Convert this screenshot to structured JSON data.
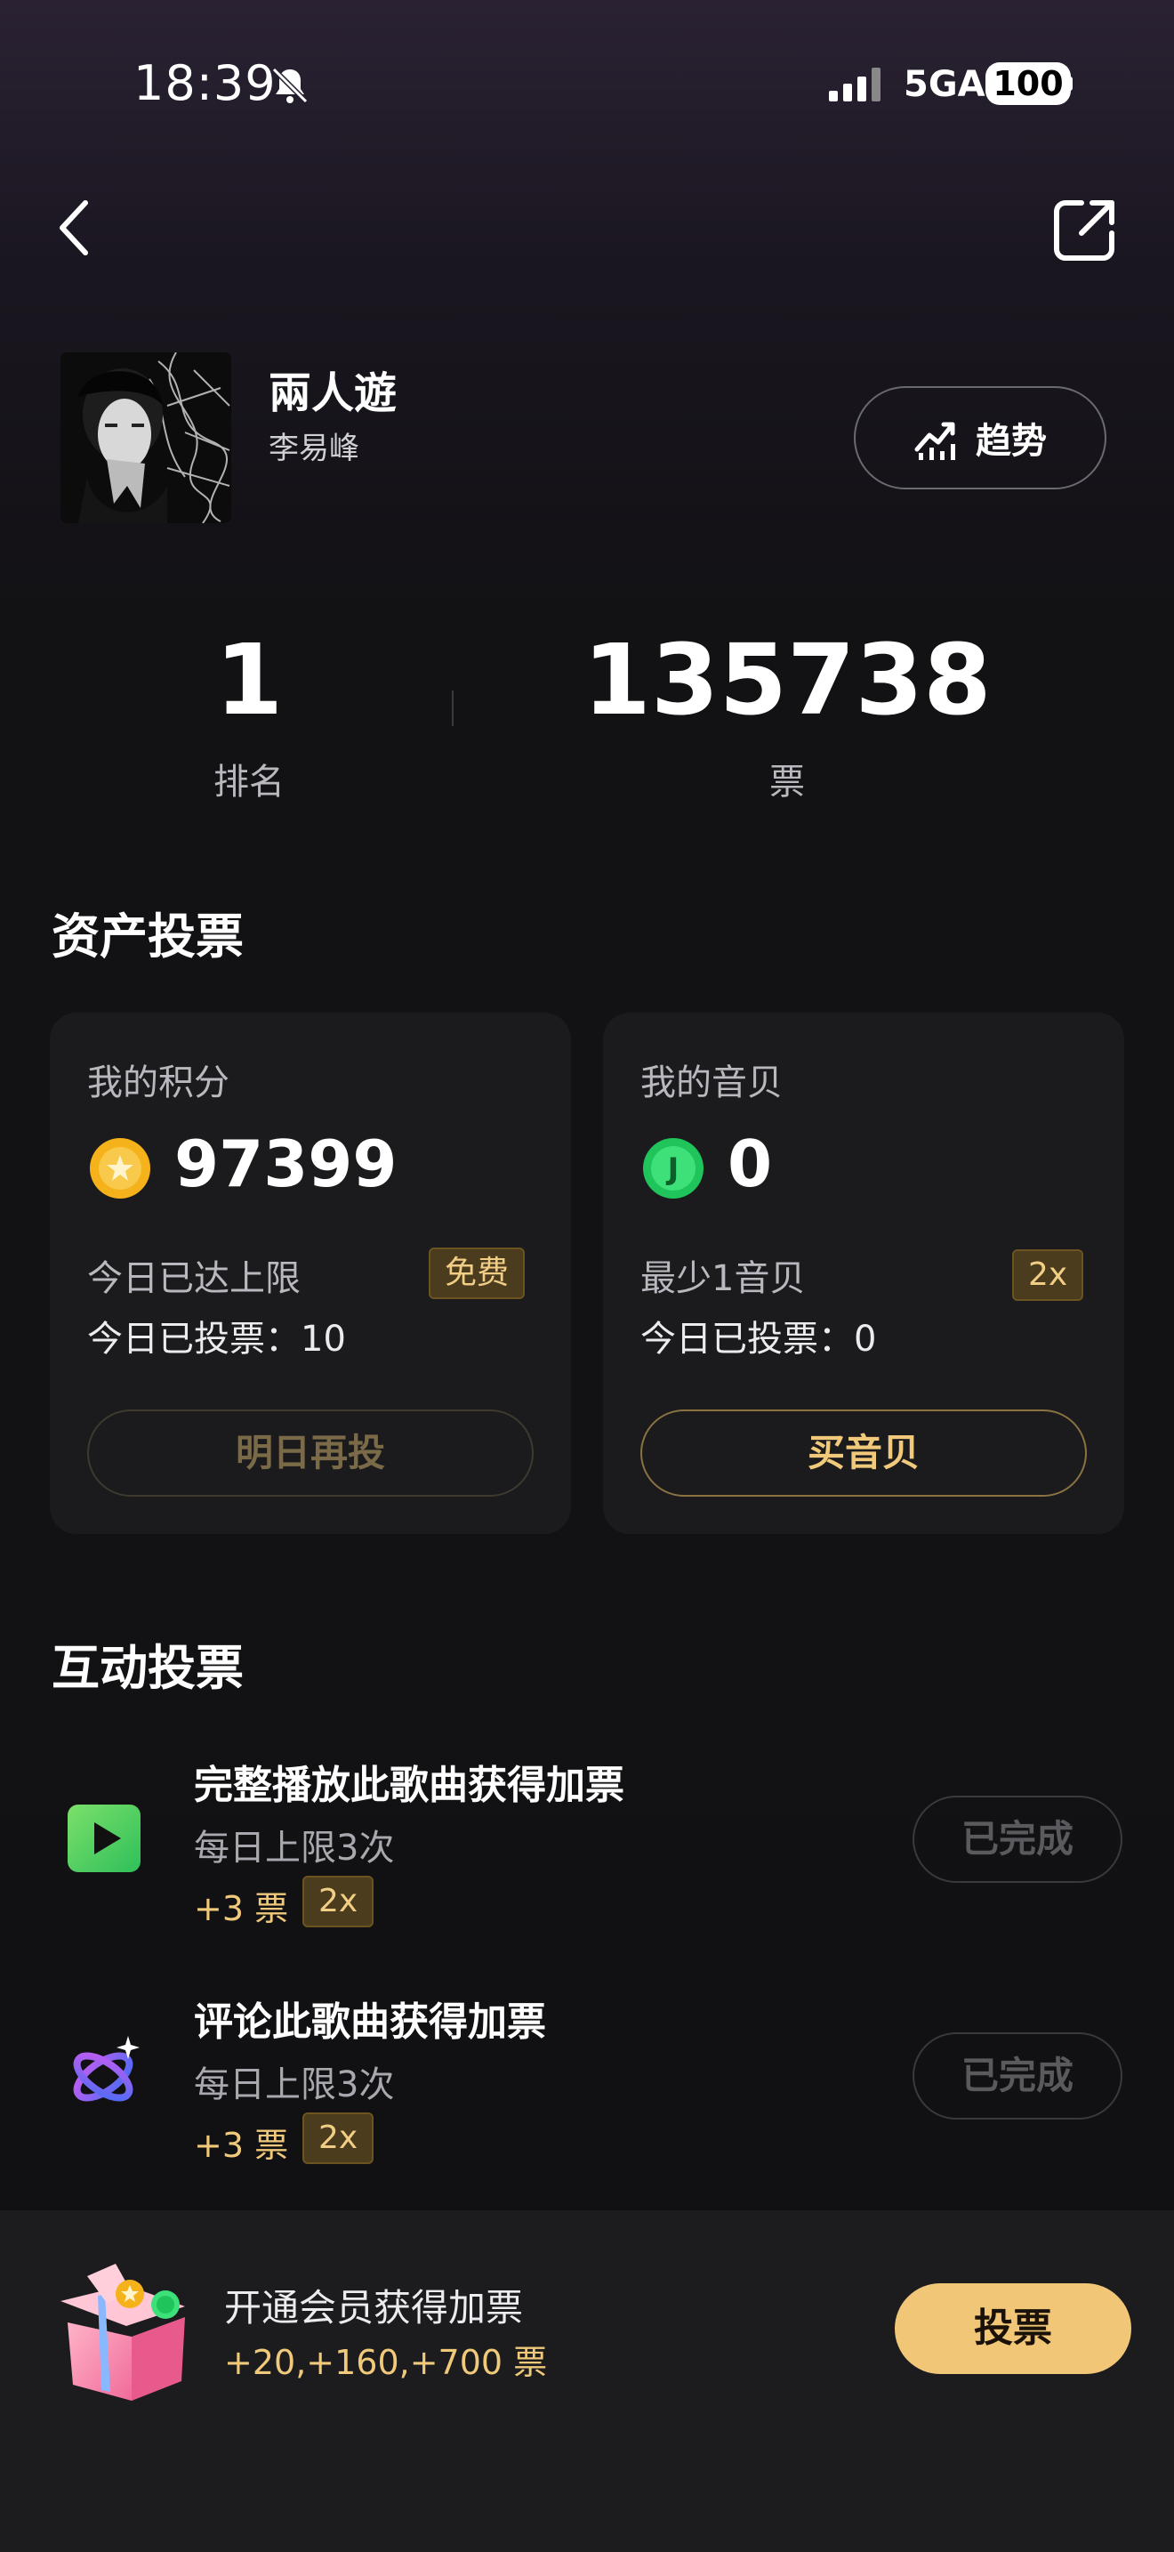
{
  "status_bar": {
    "time": "18:39",
    "network": "5GA",
    "battery": "100"
  },
  "header": {
    "back_icon": "chevron-left-icon",
    "share_icon": "share-icon"
  },
  "song": {
    "title": "兩人遊",
    "artist": "李易峰",
    "trend_label": "趋势"
  },
  "stats": {
    "rank_value": "1",
    "rank_label": "排名",
    "votes_value": "135738",
    "votes_label": "票"
  },
  "asset_section": {
    "title": "资产投票",
    "points_card": {
      "label": "我的积分",
      "value": "97399",
      "line1": "今日已达上限",
      "badge": "免费",
      "line2": "今日已投票：10",
      "button": "明日再投"
    },
    "shells_card": {
      "label": "我的音贝",
      "value": "0",
      "icon_letter": "J",
      "line1": "最少1音贝",
      "badge": "2x",
      "line2": "今日已投票：0",
      "button": "买音贝"
    }
  },
  "interactive_section": {
    "title": "互动投票",
    "tasks": [
      {
        "title": "完整播放此歌曲获得加票",
        "subtitle": "每日上限3次",
        "reward": "+3 票",
        "badge": "2x",
        "button": "已完成"
      },
      {
        "title": "评论此歌曲获得加票",
        "subtitle": "每日上限3次",
        "reward": "+3 票",
        "badge": "2x",
        "button": "已完成"
      }
    ]
  },
  "bottom_bar": {
    "title": "开通会员获得加票",
    "subtitle": "+20,+160,+700 票",
    "button": "投票"
  },
  "colors": {
    "gold": "#f2c677",
    "card_bg": "#1b1b1e"
  }
}
